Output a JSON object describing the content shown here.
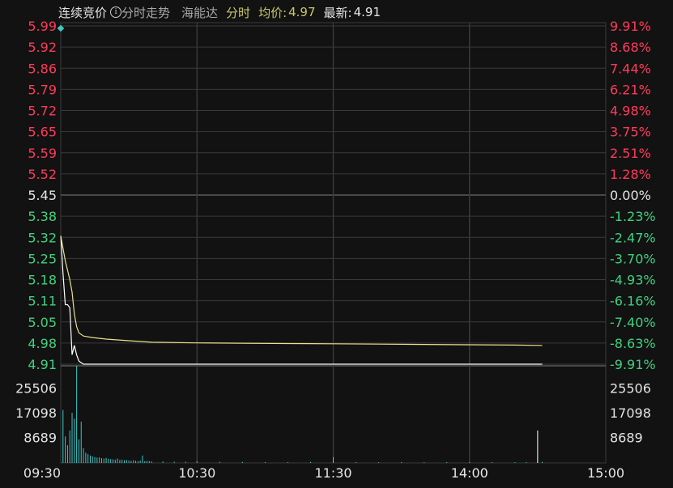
{
  "header": {
    "auction_label": "连续竞价",
    "info_icon": "info-icon",
    "chart_mode": "分时走势",
    "stock_name": "海能达",
    "period": "分时",
    "avg_label": "均价:",
    "avg_value": "4.97",
    "latest_label": "最新:",
    "latest_value": "4.91"
  },
  "colors": {
    "up": "#ff3a5a",
    "down": "#3fd27f",
    "neutral": "#e4e4e4",
    "price_line": "#ffffff",
    "avg_line": "#e6e28a",
    "volume": "#3fc7c7",
    "grid": "#3a3a3a",
    "background": "#121212"
  },
  "chart_data": [
    {
      "type": "line",
      "title": "",
      "x_ticks": [
        "09:30",
        "10:30",
        "11:30",
        "14:00",
        "15:00"
      ],
      "price_ticks": [
        "5.99",
        "5.92",
        "5.86",
        "5.79",
        "5.72",
        "5.65",
        "5.59",
        "5.52",
        "5.45",
        "5.38",
        "5.32",
        "5.25",
        "5.18",
        "5.11",
        "5.05",
        "4.98",
        "4.91"
      ],
      "percent_ticks": [
        "9.91%",
        "8.68%",
        "7.44%",
        "6.21%",
        "4.98%",
        "3.75%",
        "2.51%",
        "1.28%",
        "0.00%",
        "-1.23%",
        "-2.47%",
        "-3.70%",
        "-4.93%",
        "-6.16%",
        "-7.40%",
        "-8.63%",
        "-9.91%"
      ],
      "ylim": [
        4.91,
        5.99
      ],
      "pre_close": 5.45,
      "x_minutes_range": [
        0,
        240
      ],
      "series": [
        {
          "key": "price",
          "x_minutes": [
            0,
            1,
            2,
            3,
            4,
            5,
            6,
            7,
            8,
            9,
            10,
            12,
            16,
            20,
            40,
            80,
            120,
            160,
            200,
            212
          ],
          "values": [
            5.32,
            5.2,
            5.1,
            5.1,
            5.09,
            4.94,
            4.97,
            4.94,
            4.92,
            4.915,
            4.91,
            4.91,
            4.91,
            4.91,
            4.91,
            4.91,
            4.91,
            4.91,
            4.91,
            4.91
          ]
        },
        {
          "key": "avg",
          "x_minutes": [
            0,
            2,
            4,
            5,
            6,
            7,
            8,
            10,
            14,
            20,
            30,
            40,
            60,
            80,
            100,
            120,
            140,
            160,
            180,
            200,
            212
          ],
          "values": [
            5.32,
            5.24,
            5.18,
            5.14,
            5.07,
            5.03,
            5.01,
            5.0,
            4.995,
            4.99,
            4.985,
            4.98,
            4.978,
            4.977,
            4.976,
            4.975,
            4.974,
            4.973,
            4.972,
            4.971,
            4.97
          ]
        }
      ]
    },
    {
      "type": "bar",
      "title": "",
      "y_ticks": [
        "25506",
        "17098",
        "8689"
      ],
      "ylim": [
        0,
        33000
      ],
      "x_minutes": [
        1,
        2,
        3,
        4,
        5,
        6,
        7,
        8,
        9,
        10,
        11,
        12,
        13,
        14,
        15,
        16,
        17,
        18,
        19,
        20,
        21,
        22,
        23,
        24,
        25,
        26,
        27,
        28,
        29,
        30,
        31,
        32,
        33,
        34,
        35,
        36,
        37,
        38,
        39,
        40,
        45,
        50,
        55,
        60,
        70,
        80,
        90,
        100,
        110,
        120,
        130,
        140,
        150,
        160,
        170,
        180,
        190,
        200,
        205,
        210,
        212
      ],
      "values": [
        18000,
        9000,
        6000,
        11000,
        17000,
        15000,
        34000,
        8000,
        14000,
        5000,
        3500,
        3000,
        2500,
        2200,
        2000,
        1800,
        1900,
        1600,
        1500,
        1700,
        1400,
        1300,
        1200,
        1100,
        1500,
        1000,
        1100,
        900,
        1000,
        800,
        700,
        900,
        700,
        600,
        800,
        2500,
        600,
        700,
        600,
        500,
        500,
        400,
        400,
        600,
        400,
        350,
        300,
        300,
        350,
        2000,
        300,
        250,
        300,
        250,
        300,
        250,
        300,
        250,
        300,
        11000,
        400
      ]
    }
  ]
}
